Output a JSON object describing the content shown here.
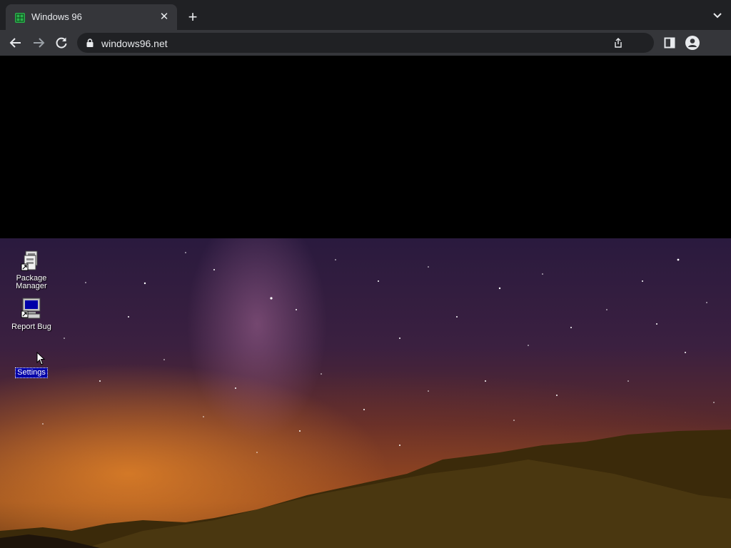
{
  "browser": {
    "tab": {
      "title": "Windows 96",
      "favicon": "windows96-favicon-icon"
    },
    "new_tab_label": "+",
    "close_tab_label": "✕",
    "address": {
      "url": "windows96.net"
    }
  },
  "desktop": {
    "icons": [
      {
        "label": "Package Manager",
        "icon": "package-manager-icon",
        "selected": false
      },
      {
        "label": "Report Bug",
        "icon": "computer-icon",
        "selected": false
      },
      {
        "label": "Settings",
        "icon": "settings-icon",
        "selected": true
      }
    ]
  },
  "colors": {
    "chrome_dark": "#202124",
    "chrome_toolbar": "#35363a",
    "selection_blue": "#0000a8"
  }
}
